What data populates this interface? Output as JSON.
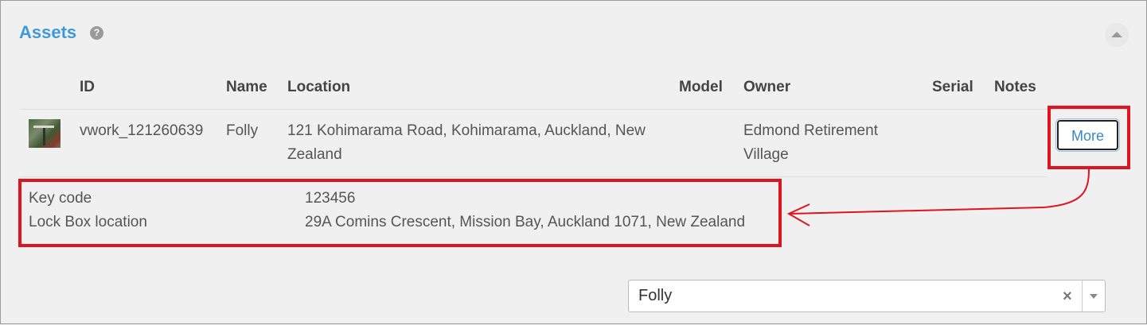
{
  "panel": {
    "title": "Assets",
    "help_icon": "question-circle-icon",
    "collapse_icon": "chevron-up-icon"
  },
  "table": {
    "headers": {
      "id": "ID",
      "name": "Name",
      "location": "Location",
      "model": "Model",
      "owner": "Owner",
      "serial": "Serial",
      "notes": "Notes"
    },
    "row": {
      "id": "vwork_121260639",
      "name": "Folly",
      "location_line1": "121 Kohimarama Road, Kohimarama, Auckland, New",
      "location_line2": "Zealand",
      "model": "",
      "owner_line1": "Edmond Retirement",
      "owner_line2": "Village",
      "serial": "",
      "more_label": "More"
    },
    "details": [
      {
        "key": "Key code",
        "value": "123456"
      },
      {
        "key": "Lock Box location",
        "value": "29A Comins Crescent, Mission Bay, Auckland 1071, New Zealand"
      }
    ]
  },
  "select": {
    "value": "Folly",
    "clear_symbol": "×"
  },
  "colors": {
    "title": "#3d9ad6",
    "annotation": "#e0141e",
    "link": "#3a86c8"
  }
}
